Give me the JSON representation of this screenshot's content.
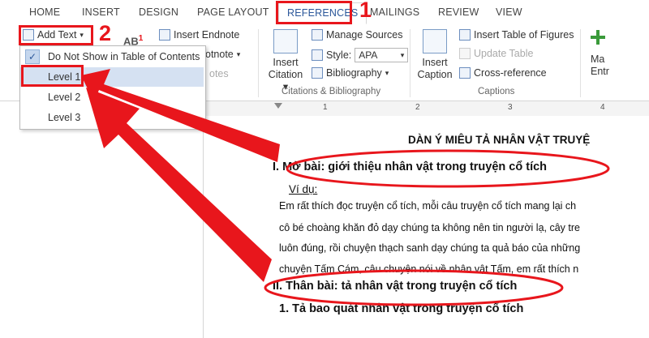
{
  "tabs": [
    "HOME",
    "INSERT",
    "DESIGN",
    "PAGE LAYOUT",
    "REFERENCES",
    "MAILINGS",
    "REVIEW",
    "VIEW"
  ],
  "ribbon": {
    "add_text": "Add Text",
    "add_text_arrow": "▾",
    "ab_label": "AB",
    "ab_sup": "1",
    "insert_endnote": "Insert Endnote",
    "next_footnote_partial": "otnote",
    "show_notes_partial": "otes",
    "insert_citation": [
      "Insert",
      "Citation"
    ],
    "manage_sources": "Manage Sources",
    "style_label": "Style:",
    "style_value": "APA",
    "bibliography": "Bibliography",
    "insert_caption": [
      "Insert",
      "Caption"
    ],
    "insert_table_of_figures": "Insert Table of Figures",
    "update_table": "Update Table",
    "cross_reference": "Cross-reference",
    "mark_entry_partial": [
      "Ma",
      "Entr"
    ],
    "group_citations": "Citations & Bibliography",
    "group_captions": "Captions"
  },
  "dropdown": {
    "items": [
      "Do Not Show in Table of Contents",
      "Level 1",
      "Level 2",
      "Level 3"
    ],
    "checked_index": 0,
    "highlighted_index": 1
  },
  "ruler": {
    "numbers": [
      "1",
      "2",
      "3",
      "4"
    ]
  },
  "document": {
    "title": "DÀN Ý MIÊU TẢ NHÂN VẬT TRUYỆ",
    "h1": "I.  Mở bài: giới thiệu nhân vật trong truyện cổ tích",
    "example_label": "Ví dụ:",
    "p1": "Em rất thích đọc truyện cổ tích, mỗi câu truyện cổ tích mang lại ch",
    "p2": "cô bé choàng khăn đỏ dạy chúng ta không nên tin người lạ, cây tre",
    "p3": "luôn đúng, rồi chuyện thạch sanh dạy chúng ta quả báo của những",
    "p4": "chuyện Tấm Cám, câu chuyện nói về nhân vật Tấm, em rất thích n",
    "h2": "II.  Thân bài: tả nhân vật trong truyện cổ tích",
    "h3": "1.  Tả bao quát nhân vật trong truyện cổ tích"
  },
  "annotations": {
    "step1": "1",
    "step2": "2"
  },
  "colors": {
    "accent": "#2b579a",
    "annotation_red": "#e8161c",
    "highlight": "#d5e1f2"
  }
}
